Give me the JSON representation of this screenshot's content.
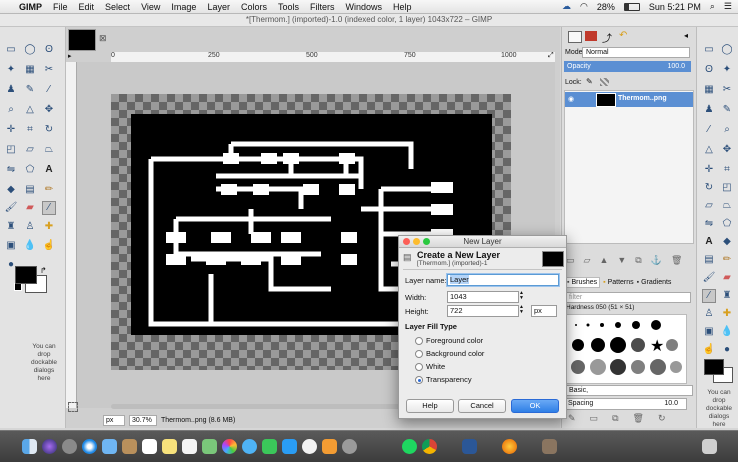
{
  "menubar": {
    "app": "GIMP",
    "items": [
      "File",
      "Edit",
      "Select",
      "View",
      "Image",
      "Layer",
      "Colors",
      "Tools",
      "Filters",
      "Windows",
      "Help"
    ],
    "battery": "28%",
    "clock": "Sun 5:21 PM"
  },
  "window": {
    "title": "*[Thermom.] (imported)-1.0 (indexed color, 1 layer) 1043x722 – GIMP"
  },
  "toolbox": {
    "hint": "You can drop dockable dialogs here",
    "fg_color": "#000000",
    "bg_color": "#ffffff"
  },
  "ruler": {
    "ticks": [
      "0",
      "250",
      "500",
      "750",
      "1000"
    ]
  },
  "status": {
    "unit": "px",
    "zoom": "30.7%",
    "file": "Thermom..png (8.6 MB)"
  },
  "layers_panel": {
    "mode_label": "Mode:",
    "mode_value": "Normal",
    "opacity_label": "Opacity",
    "opacity_value": "100.0",
    "lock_label": "Lock:",
    "layer_name": "Thermom..png"
  },
  "brushes_panel": {
    "tabs": [
      "Brushes",
      "Patterns",
      "Gradients"
    ],
    "filter_placeholder": "filter",
    "brush_name": "Hardness 050 (51 × 51)",
    "preset": "Basic,",
    "spacing_label": "Spacing",
    "spacing_value": "10.0"
  },
  "dialog": {
    "title": "New Layer",
    "heading": "Create a New Layer",
    "subheading": "[Thermom.] (imported)-1",
    "layer_name_label": "Layer name:",
    "layer_name_value": "Layer",
    "width_label": "Width:",
    "width_value": "1043",
    "height_label": "Height:",
    "height_value": "722",
    "unit": "px",
    "fill_type_label": "Layer Fill Type",
    "fill_options": [
      "Foreground color",
      "Background color",
      "White",
      "Transparency"
    ],
    "selected_fill": 3,
    "help_button": "Help",
    "cancel_button": "Cancel",
    "ok_button": "OK"
  },
  "colors": {
    "accent": "#3b7ddd",
    "layer_selected": "#5b8fd3"
  }
}
